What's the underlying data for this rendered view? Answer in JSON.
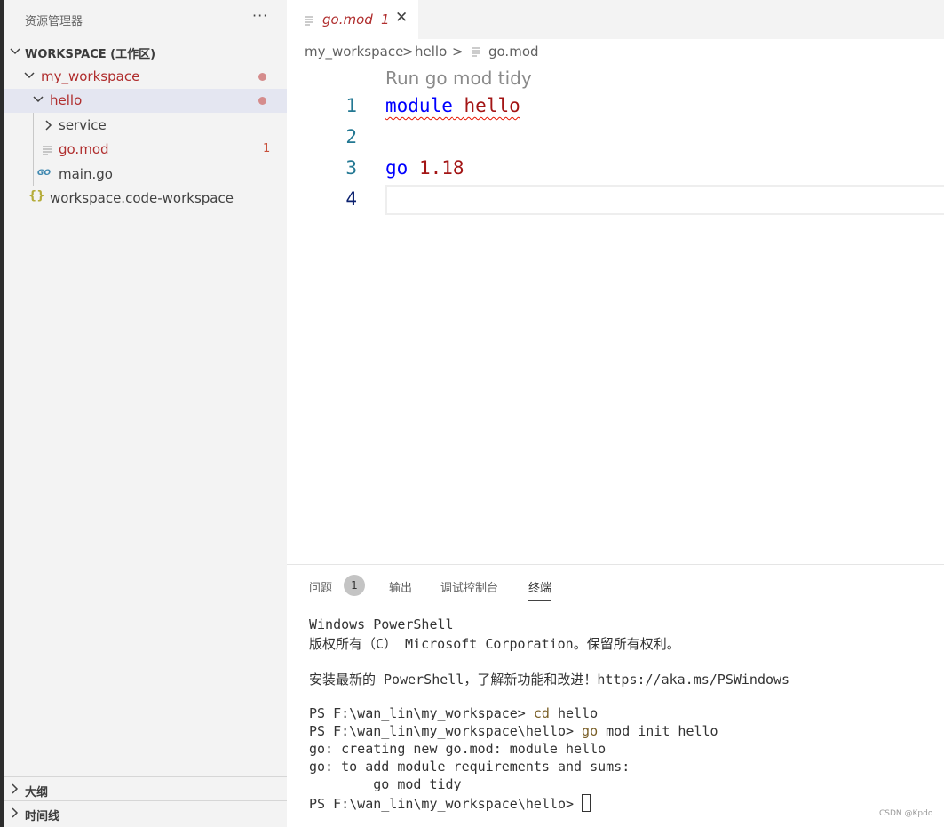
{
  "sidebar": {
    "title": "资源管理器",
    "more": "···",
    "workspace_label": "WORKSPACE (工作区)",
    "tree": [
      {
        "label": "my_workspace",
        "color": "#b02e2e"
      },
      {
        "label": "hello",
        "color": "#b02e2e"
      },
      {
        "label": "service",
        "color": "#424242"
      },
      {
        "label": "go.mod",
        "color": "#b02e2e",
        "badge": "1"
      },
      {
        "label": "main.go",
        "color": "#424242"
      },
      {
        "label": "workspace.code-workspace",
        "color": "#424242"
      }
    ],
    "outline": "大纲",
    "timeline": "时间线"
  },
  "tab": {
    "name": "go.mod",
    "problems": "1",
    "close": "✕"
  },
  "breadcrumb": {
    "p1": "my_workspace",
    "p2": "hello",
    "p3": "go.mod",
    "sep": ">"
  },
  "editor": {
    "codelens": "Run go mod tidy",
    "line_numbers": [
      "1",
      "2",
      "3",
      "4"
    ],
    "line1_kw": "module",
    "line1_val": "hello",
    "line3_kw": "go",
    "line3_val": "1.18"
  },
  "panel": {
    "tabs": [
      "问题",
      "输出",
      "调试控制台",
      "终端"
    ],
    "problems_count": "1",
    "terminal": {
      "l1": "Windows PowerShell",
      "l2": "版权所有（C） Microsoft Corporation。保留所有权利。",
      "l3": "安装最新的 PowerShell，了解新功能和改进！https://aka.ms/PSWindows",
      "p1": "PS F:\\wan_lin\\my_workspace> ",
      "c1": "cd",
      "a1": " hello",
      "p2": "PS F:\\wan_lin\\my_workspace\\hello> ",
      "c2": "go",
      "a2": " mod init hello",
      "l4": "go: creating new go.mod: module hello",
      "l5": "go: to add module requirements and sums:",
      "l6": "        go mod tidy",
      "p3": "PS F:\\wan_lin\\my_workspace\\hello> "
    }
  },
  "watermark": "CSDN @Kpdo",
  "colors": {
    "accent_error": "#b02e2e",
    "keyword": "#0000ff",
    "string": "#a31515",
    "line_number": "#237893"
  }
}
